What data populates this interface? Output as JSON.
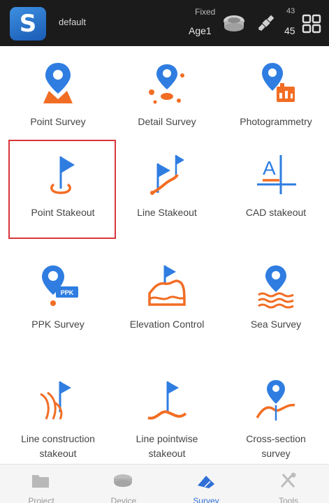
{
  "status_bar": {
    "app_name": "S",
    "project": "default",
    "fix_status": "Fixed",
    "age": "Age1",
    "sat_used": "43",
    "sat_total": "45"
  },
  "tiles": [
    {
      "label": "Point Survey",
      "icon": "point-survey-icon"
    },
    {
      "label": "Detail Survey",
      "icon": "detail-survey-icon"
    },
    {
      "label": "Photogrammetry",
      "icon": "photogrammetry-icon"
    },
    {
      "label": "Point Stakeout",
      "icon": "point-stakeout-icon",
      "selected": true
    },
    {
      "label": "Line Stakeout",
      "icon": "line-stakeout-icon"
    },
    {
      "label": "CAD stakeout",
      "icon": "cad-stakeout-icon"
    },
    {
      "label": "PPK Survey",
      "icon": "ppk-survey-icon"
    },
    {
      "label": "Elevation Control",
      "icon": "elevation-control-icon"
    },
    {
      "label": "Sea Survey",
      "icon": "sea-survey-icon"
    },
    {
      "label": "Line construction\nstakeout",
      "icon": "line-construction-stakeout-icon"
    },
    {
      "label": "Line pointwise\nstakeout",
      "icon": "line-pointwise-stakeout-icon"
    },
    {
      "label": "Cross-section\nsurvey",
      "icon": "cross-section-survey-icon"
    }
  ],
  "bottom_nav": [
    {
      "label": "Project",
      "icon": "project-icon"
    },
    {
      "label": "Device",
      "icon": "device-icon"
    },
    {
      "label": "Survey",
      "icon": "survey-icon",
      "active": true
    },
    {
      "label": "Tools",
      "icon": "tools-icon"
    }
  ],
  "colors": {
    "accent_blue": "#2f7de1",
    "accent_orange": "#f26d24",
    "selection_red": "#d8353c",
    "topbar_bg": "#1b1b1b"
  }
}
